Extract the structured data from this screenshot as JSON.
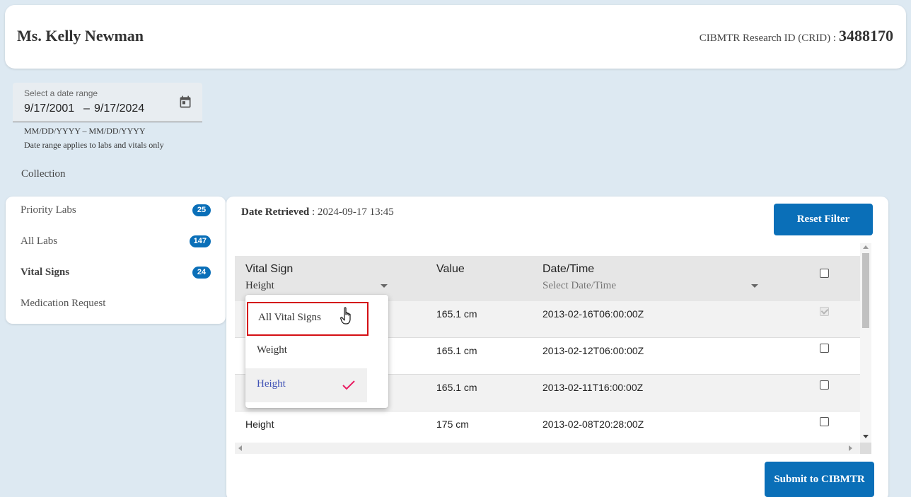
{
  "header": {
    "patient_name": "Ms. Kelly Newman",
    "crid_label": "CIBMTR Research ID (CRID) :",
    "crid_value": "3488170"
  },
  "date_range": {
    "label": "Select a date range",
    "start": "9/17/2001",
    "separator": "–",
    "end": "9/17/2024",
    "hint": "MM/DD/YYYY – MM/DD/YYYY",
    "note": "Date range applies to labs and vitals only",
    "icon": "calendar-icon"
  },
  "collection_label": "Collection",
  "sidebar": {
    "items": [
      {
        "label": "Priority Labs",
        "count": "25",
        "active": false
      },
      {
        "label": "All Labs",
        "count": "147",
        "active": false
      },
      {
        "label": "Vital Signs",
        "count": "24",
        "active": true
      },
      {
        "label": "Medication Request",
        "count": "",
        "active": false
      }
    ]
  },
  "main": {
    "retrieved_label": "Date Retrieved",
    "retrieved_value": ": 2024-09-17 13:45",
    "reset_button": "Reset Filter",
    "submit_button": "Submit to CIBMTR"
  },
  "table": {
    "headers": {
      "vital_sign": "Vital Sign",
      "value": "Value",
      "datetime": "Date/Time"
    },
    "filters": {
      "vital_sign_value": "Height",
      "datetime_placeholder": "Select Date/Time"
    },
    "rows": [
      {
        "vital_sign": "",
        "value": "165.1 cm",
        "datetime": "2013-02-16T06:00:00Z",
        "checked": true,
        "disabled": true
      },
      {
        "vital_sign": "",
        "value": "165.1 cm",
        "datetime": "2013-02-12T06:00:00Z",
        "checked": false,
        "disabled": false
      },
      {
        "vital_sign": "",
        "value": "165.1 cm",
        "datetime": "2013-02-11T16:00:00Z",
        "checked": false,
        "disabled": false
      },
      {
        "vital_sign": "Height",
        "value": "175 cm",
        "datetime": "2013-02-08T20:28:00Z",
        "checked": false,
        "disabled": false
      }
    ]
  },
  "dropdown": {
    "options": [
      {
        "label": "All Vital Signs",
        "selected": false,
        "hovered": true
      },
      {
        "label": "Weight",
        "selected": false,
        "hovered": false
      },
      {
        "label": "Height",
        "selected": true,
        "hovered": false
      }
    ],
    "selected_color": "#3f51b5",
    "check_color": "#e91e63"
  },
  "colors": {
    "accent": "#0a6fb8",
    "background": "#dde9f2",
    "highlight_outline": "#d40f14"
  }
}
